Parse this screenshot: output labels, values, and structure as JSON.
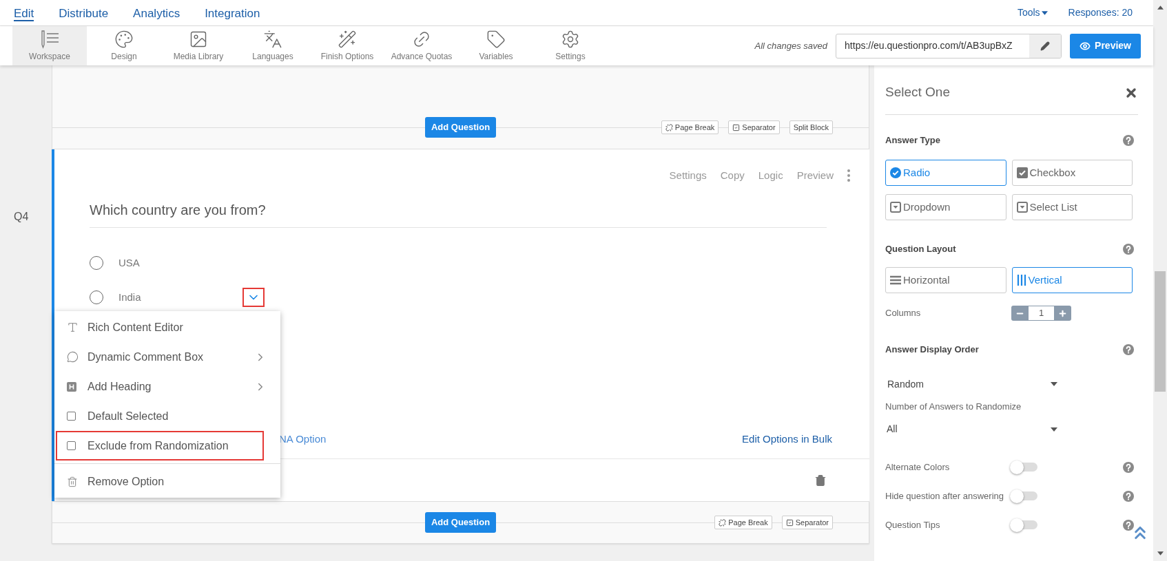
{
  "nav": {
    "tabs": [
      {
        "label": "Edit",
        "selected": true
      },
      {
        "label": "Distribute",
        "selected": false
      },
      {
        "label": "Analytics",
        "selected": false
      },
      {
        "label": "Integration",
        "selected": false
      }
    ],
    "tools": "Tools",
    "responses": "Responses: 20"
  },
  "toolbar": {
    "items": [
      {
        "label": "Workspace",
        "kind": "workspace",
        "selected": true
      },
      {
        "label": "Design",
        "kind": "palette",
        "selected": false
      },
      {
        "label": "Media Library",
        "kind": "image",
        "selected": false
      },
      {
        "label": "Languages",
        "kind": "languages",
        "selected": false
      },
      {
        "label": "Finish Options",
        "kind": "wand",
        "selected": false
      },
      {
        "label": "Advance Quotas",
        "kind": "chain",
        "selected": false
      },
      {
        "label": "Variables",
        "kind": "tag",
        "selected": false
      },
      {
        "label": "Settings",
        "kind": "gear",
        "selected": false
      }
    ],
    "save_status": "All changes saved",
    "url": "https://eu.questionpro.com/t/AB3upBxZ",
    "preview": "Preview"
  },
  "block_above": {
    "add_question": "Add Question",
    "actions": [
      {
        "label": "Page Break",
        "kind": "unlink"
      },
      {
        "label": "Separator",
        "kind": "check"
      },
      {
        "label": "Split Block",
        "kind": "plain"
      }
    ]
  },
  "question": {
    "number": "Q4",
    "actions": [
      "Settings",
      "Copy",
      "Logic",
      "Preview"
    ],
    "text": "Which country are you from?",
    "options": [
      {
        "label": "USA",
        "selected": false,
        "menu_open": false
      },
      {
        "label": "India",
        "selected": false,
        "menu_open": true
      }
    ],
    "na_option": "NA Option",
    "bulk_edit": "Edit Options in Bulk"
  },
  "option_menu": {
    "items": [
      {
        "kind": "editor",
        "label": "Rich Content Editor",
        "submenu": false,
        "highlighted": false
      },
      {
        "kind": "comment",
        "label": "Dynamic Comment Box",
        "submenu": true,
        "highlighted": false
      },
      {
        "kind": "heading",
        "label": "Add Heading",
        "submenu": true,
        "highlighted": false
      },
      {
        "kind": "checkbox",
        "label": "Default Selected",
        "checked": false,
        "submenu": false,
        "highlighted": false
      },
      {
        "kind": "checkbox",
        "label": "Exclude from Randomization",
        "checked": false,
        "submenu": false,
        "highlighted": true
      },
      {
        "kind": "remove",
        "label": "Remove Option",
        "submenu": false,
        "highlighted": false
      }
    ]
  },
  "block_below": {
    "add_question": "Add Question",
    "actions": [
      {
        "label": "Page Break",
        "kind": "unlink"
      },
      {
        "label": "Separator",
        "kind": "check"
      }
    ]
  },
  "panel": {
    "title": "Select One",
    "answer_type": {
      "heading": "Answer Type",
      "choices": [
        {
          "label": "Radio",
          "kind": "radio",
          "selected": true
        },
        {
          "label": "Checkbox",
          "kind": "checkbox",
          "selected": false
        },
        {
          "label": "Dropdown",
          "kind": "dropdown",
          "selected": false
        },
        {
          "label": "Select List",
          "kind": "dropdown",
          "selected": false
        }
      ]
    },
    "layout": {
      "heading": "Question Layout",
      "choices": [
        {
          "label": "Horizontal",
          "kind": "rows",
          "selected": false
        },
        {
          "label": "Vertical",
          "kind": "columns",
          "selected": true
        }
      ],
      "columns_label": "Columns",
      "columns_value": "1"
    },
    "display_order": {
      "heading": "Answer Display Order",
      "order": "Random",
      "count_label": "Number of Answers to Randomize",
      "count": "All"
    },
    "toggles": [
      {
        "label": "Alternate Colors",
        "on": false
      },
      {
        "label": "Hide question after answering",
        "on": false
      },
      {
        "label": "Question Tips",
        "on": false
      }
    ]
  }
}
